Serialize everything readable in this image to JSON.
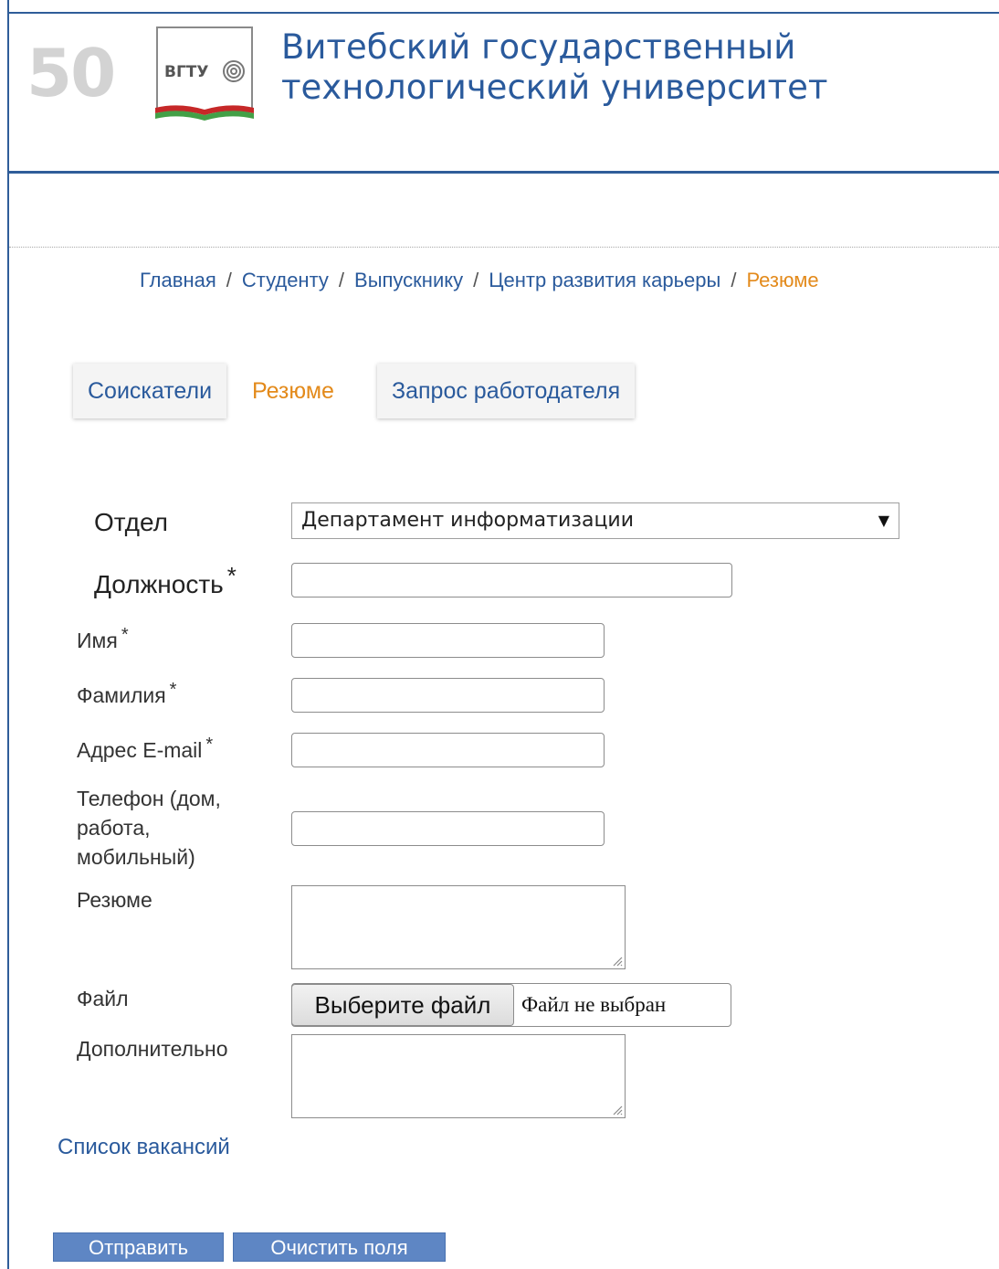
{
  "header": {
    "anniversary": "50",
    "logo_text": "ВГТУ",
    "title_line1": "Витебский государственный",
    "title_line2": "технологический университет"
  },
  "breadcrumb": {
    "items": [
      "Главная",
      "Студенту",
      "Выпускнику",
      "Центр развития карьеры"
    ],
    "current": "Резюме",
    "separator": "/"
  },
  "tabs": [
    {
      "label": "Соискатели",
      "active": false
    },
    {
      "label": "Резюме",
      "active": true
    },
    {
      "label": "Запрос работодателя",
      "active": false
    }
  ],
  "form": {
    "department": {
      "label": "Отдел",
      "selected": "Департамент информатизации"
    },
    "position": {
      "label": "Должность",
      "required": "*",
      "value": ""
    },
    "first_name": {
      "label": "Имя",
      "required": "*",
      "value": ""
    },
    "last_name": {
      "label": "Фамилия",
      "required": "*",
      "value": ""
    },
    "email": {
      "label": "Адрес E-mail",
      "required": "*",
      "value": ""
    },
    "phone": {
      "label_lines": [
        "Телефон (дом,",
        "работа,",
        "мобильный)"
      ],
      "value": ""
    },
    "resume": {
      "label": "Резюме",
      "value": ""
    },
    "file": {
      "label": "Файл",
      "button": "Выберите файл",
      "status": "Файл не выбран"
    },
    "extra": {
      "label": "Дополнительно",
      "value": ""
    }
  },
  "links": {
    "vacancies": "Список вакансий"
  },
  "actions": {
    "submit": "Отправить",
    "reset": "Очистить поля"
  },
  "colors": {
    "brand_blue": "#2a5a9c",
    "accent_orange": "#e38a1b",
    "button_blue": "#5e86c4"
  }
}
